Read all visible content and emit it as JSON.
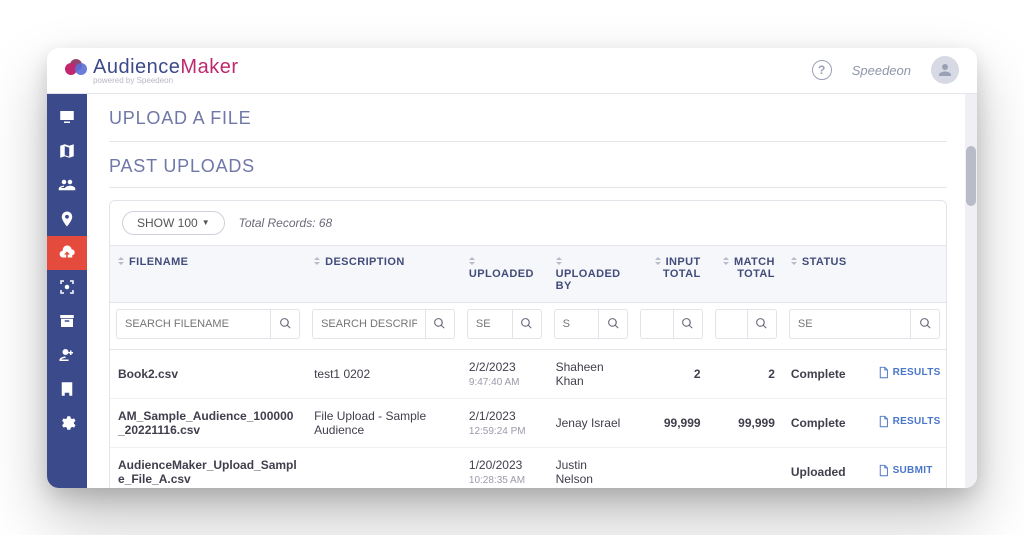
{
  "brand": {
    "word1": "Audience",
    "word2": "Maker",
    "tagline": "powered by Speedeon"
  },
  "topbar": {
    "username": "Speedeon"
  },
  "sidebar": {
    "items": [
      {
        "name": "dashboard-icon"
      },
      {
        "name": "map-icon"
      },
      {
        "name": "audiences-icon"
      },
      {
        "name": "location-icon"
      },
      {
        "name": "upload-icon",
        "active": true
      },
      {
        "name": "capture-icon"
      },
      {
        "name": "archive-icon"
      },
      {
        "name": "user-plus-icon"
      },
      {
        "name": "building-icon"
      },
      {
        "name": "settings-icon"
      }
    ]
  },
  "titles": {
    "upload": "UPLOAD A FILE",
    "past": "PAST UPLOADS"
  },
  "toolbar": {
    "show_label": "SHOW 100",
    "records_label": "Total Records: 68"
  },
  "columns": {
    "filename": "FILENAME",
    "description": "DESCRIPTION",
    "uploaded": "UPLOADED",
    "uploaded_by": "UPLOADED BY",
    "input_total": "INPUT TOTAL",
    "match_total": "MATCH TOTAL",
    "status": "STATUS"
  },
  "filters": {
    "filename": "SEARCH FILENAME",
    "description": "SEARCH DESCRIPTION",
    "uploaded": "SE",
    "uploaded_by": "S",
    "input_total": "",
    "match_total": "",
    "status": "SE"
  },
  "rows": [
    {
      "filename": "Book2.csv",
      "description": "test1 0202",
      "uploaded_date": "2/2/2023",
      "uploaded_time": "9:47:40 AM",
      "uploaded_by": "Shaheen Khan",
      "input_total": "2",
      "match_total": "2",
      "status": "Complete",
      "action": "RESULTS"
    },
    {
      "filename": "AM_Sample_Audience_100000_20221116.csv",
      "description": "File Upload - Sample Audience",
      "uploaded_date": "2/1/2023",
      "uploaded_time": "12:59:24 PM",
      "uploaded_by": "Jenay Israel",
      "input_total": "99,999",
      "match_total": "99,999",
      "status": "Complete",
      "action": "RESULTS"
    },
    {
      "filename": "AudienceMaker_Upload_Sample_File_A.csv",
      "description": "",
      "uploaded_date": "1/20/2023",
      "uploaded_time": "10:28:35 AM",
      "uploaded_by": "Justin Nelson",
      "input_total": "",
      "match_total": "",
      "status": "Uploaded",
      "action": "SUBMIT"
    }
  ]
}
